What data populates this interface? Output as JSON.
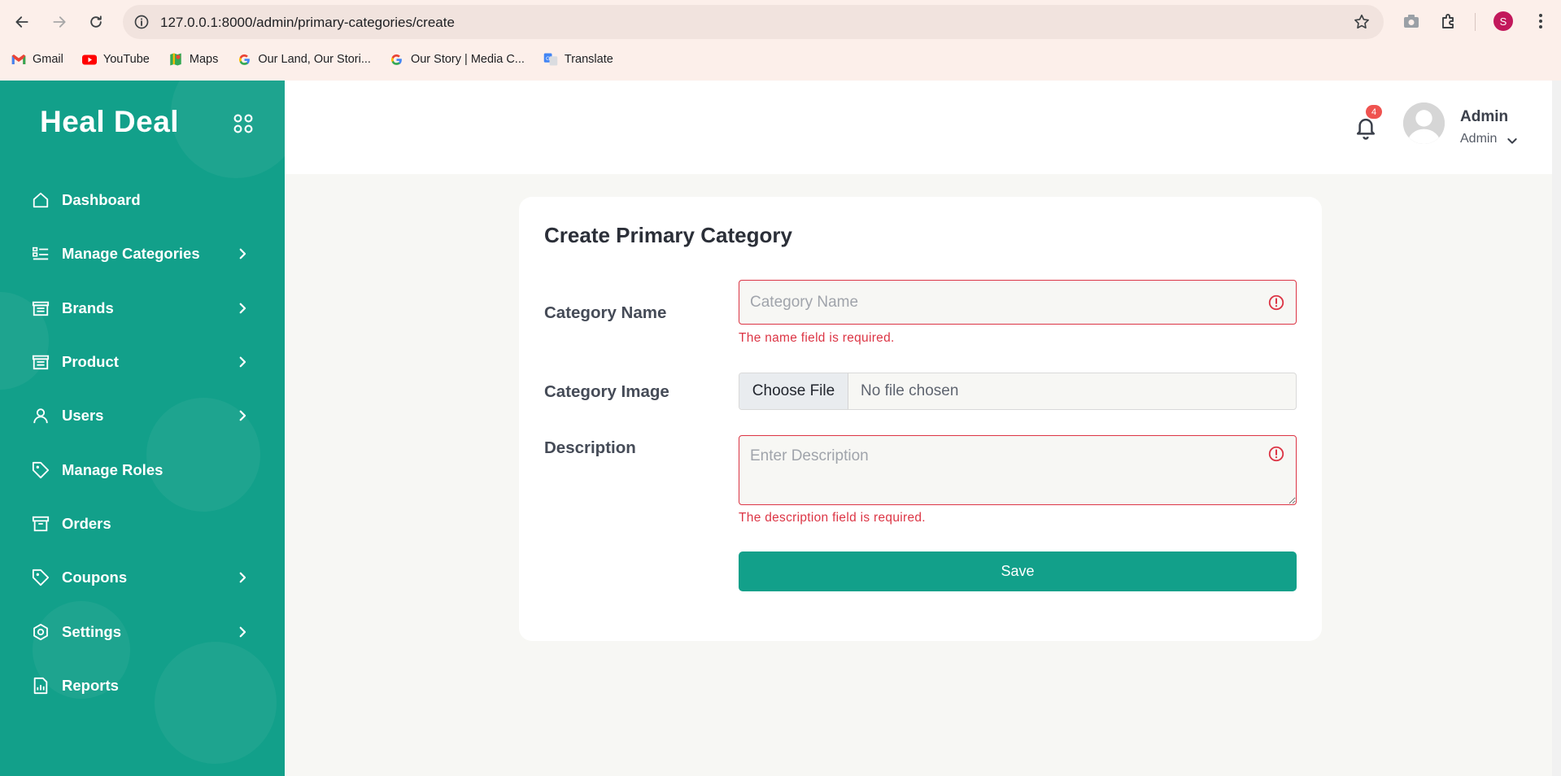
{
  "browser": {
    "url": "127.0.0.1:8000/admin/primary-categories/create",
    "profile_initial": "S",
    "bookmarks": [
      {
        "label": "Gmail",
        "icon": "gmail-icon"
      },
      {
        "label": "YouTube",
        "icon": "youtube-icon"
      },
      {
        "label": "Maps",
        "icon": "maps-icon"
      },
      {
        "label": "Our Land, Our Stori...",
        "icon": "google-icon"
      },
      {
        "label": "Our Story | Media C...",
        "icon": "google-icon"
      },
      {
        "label": "Translate",
        "icon": "translate-icon"
      }
    ]
  },
  "sidebar": {
    "brand": "Heal Deal",
    "bg_color": "#12a08a",
    "items": [
      {
        "label": "Dashboard",
        "icon": "home-icon",
        "has_submenu": false
      },
      {
        "label": "Manage Categories",
        "icon": "list-icon",
        "has_submenu": true
      },
      {
        "label": "Brands",
        "icon": "store-icon",
        "has_submenu": true
      },
      {
        "label": "Product",
        "icon": "store-icon",
        "has_submenu": true
      },
      {
        "label": "Users",
        "icon": "user-icon",
        "has_submenu": true
      },
      {
        "label": "Manage Roles",
        "icon": "tag-icon",
        "has_submenu": false
      },
      {
        "label": "Orders",
        "icon": "archive-icon",
        "has_submenu": false
      },
      {
        "label": "Coupons",
        "icon": "tag-icon",
        "has_submenu": true
      },
      {
        "label": "Settings",
        "icon": "gear-icon",
        "has_submenu": true
      },
      {
        "label": "Reports",
        "icon": "report-icon",
        "has_submenu": false
      }
    ]
  },
  "header": {
    "notification_count": "4",
    "user_name": "Admin",
    "user_role": "Admin"
  },
  "form": {
    "title": "Create Primary Category",
    "name_label": "Category Name",
    "name_placeholder": "Category Name",
    "name_value": "",
    "name_error": "The name field is required.",
    "image_label": "Category Image",
    "file_button": "Choose File",
    "file_status": "No file chosen",
    "description_label": "Description",
    "description_placeholder": "Enter Description",
    "description_value": "",
    "description_error": "The description field is required.",
    "save_label": "Save",
    "error_color": "#dc3545",
    "accent_color": "#12a08a"
  }
}
